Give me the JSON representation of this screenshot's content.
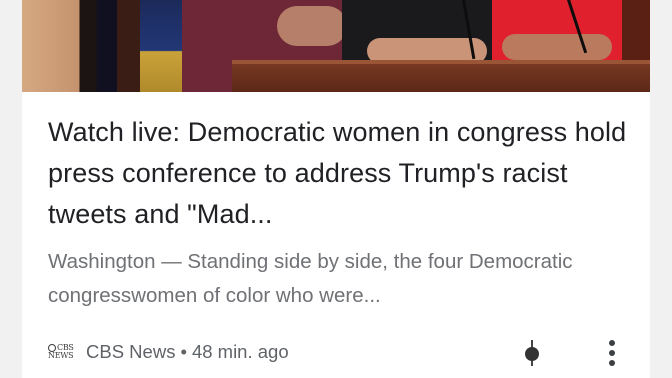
{
  "article": {
    "headline": "Watch live: Democratic women in congress hold press conference to address Trump's racist tweets and \"Mad...",
    "snippet": "Washington — Standing side by side, the four Democratic congresswomen of color who were...",
    "source_name": "CBS News",
    "separator": "•",
    "time_ago": "48 min. ago",
    "source_logo_text": {
      "line1": "CBS",
      "line2": "NEWS"
    }
  },
  "icons": {
    "source_logo": "cbs-eye-logo",
    "pin": "pushpin-icon",
    "more": "vertical-ellipsis-icon"
  },
  "colors": {
    "headline": "#202124",
    "snippet": "#6f7175",
    "meta": "#5f6368",
    "card_background": "#ffffff",
    "page_background": "#f1f1f1"
  }
}
